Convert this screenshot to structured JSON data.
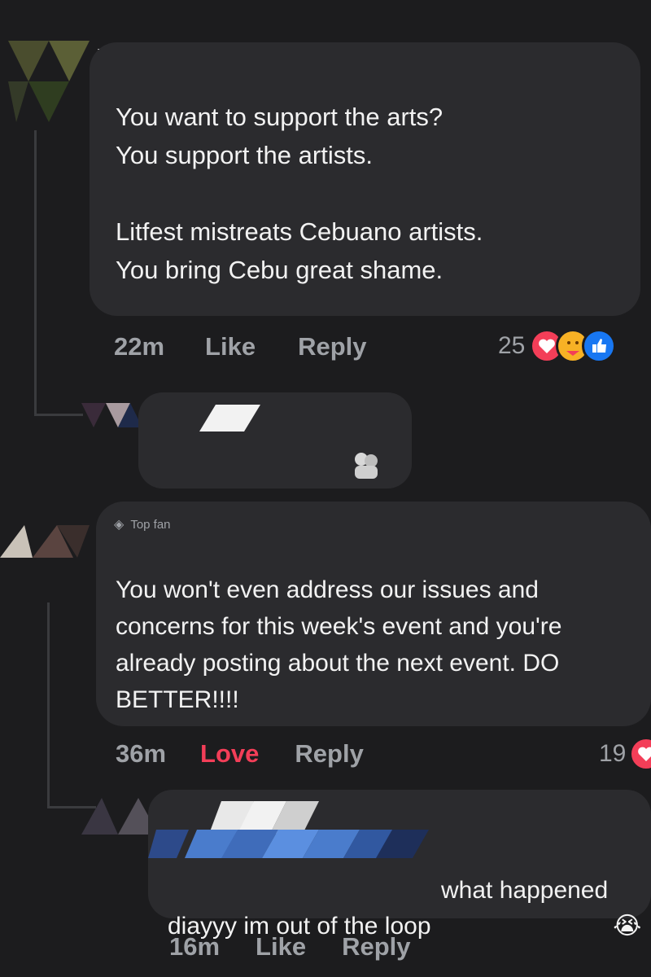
{
  "comments": [
    {
      "text": "You want to support the arts?\nYou support the artists.\n\nLitfest mistreats Cebuano artists.\nYou bring Cebu great shame.",
      "time": "22m",
      "like_label": "Like",
      "reply_label": "Reply",
      "reaction_count": "25",
      "reactions": [
        "heart-icon",
        "care-icon",
        "like-icon"
      ]
    },
    {
      "badge": "Top fan",
      "text": "You won't even address our issues and concerns for this week's event and you're already posting about the next event. DO BETTER!!!!",
      "time": "36m",
      "like_label": "Love",
      "reply_label": "Reply",
      "reaction_count": "19",
      "reactions": [
        "heart-icon"
      ]
    },
    {
      "text": "what happened\ndiayyy im out of the loop",
      "emoji": "😭",
      "time": "16m",
      "like_label": "Like",
      "reply_label": "Reply"
    }
  ],
  "colors": {
    "background": "#1c1c1e",
    "bubble": "#2b2b2e",
    "love": "#f33e58",
    "muted": "#9fa2a7"
  }
}
